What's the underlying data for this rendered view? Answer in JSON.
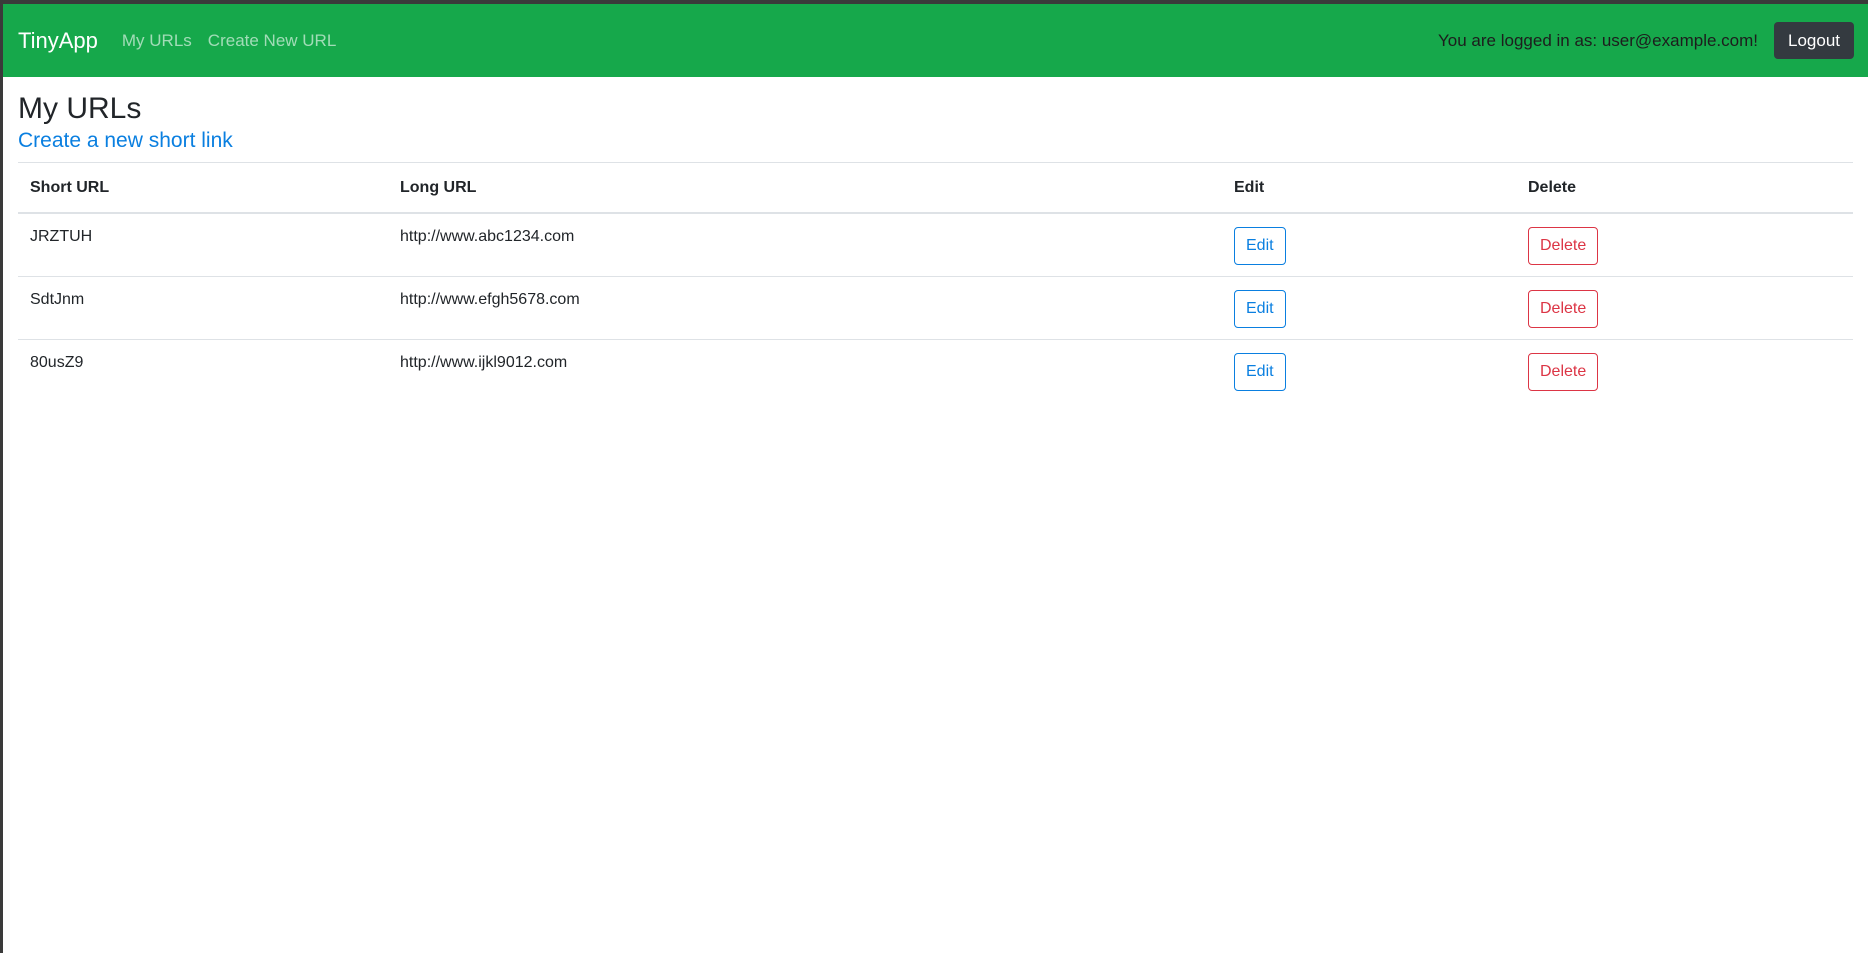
{
  "navbar": {
    "brand": "TinyApp",
    "links": [
      {
        "label": "My URLs"
      },
      {
        "label": "Create New URL"
      }
    ],
    "login_text": "You are logged in as: user@example.com!",
    "logout_label": "Logout"
  },
  "colors": {
    "navbar_bg": "#16a84b",
    "link": "#0a7fe0",
    "danger": "#dc3545",
    "dark_button": "#343a40"
  },
  "main": {
    "title": "My URLs",
    "create_link": "Create a new short link",
    "table": {
      "headers": [
        "Short URL",
        "Long URL",
        "Edit",
        "Delete"
      ],
      "rows": [
        {
          "short_url": "JRZTUH",
          "long_url": "http://www.abc1234.com",
          "edit_label": "Edit",
          "delete_label": "Delete"
        },
        {
          "short_url": "SdtJnm",
          "long_url": "http://www.efgh5678.com",
          "edit_label": "Edit",
          "delete_label": "Delete"
        },
        {
          "short_url": "80usZ9",
          "long_url": "http://www.ijkl9012.com",
          "edit_label": "Edit",
          "delete_label": "Delete"
        }
      ]
    }
  }
}
